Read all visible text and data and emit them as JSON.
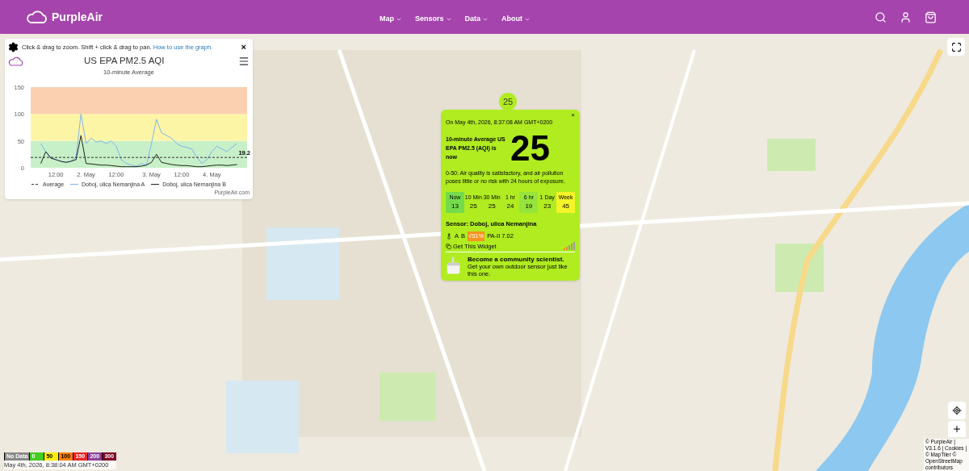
{
  "header": {
    "brand": "PurpleAir",
    "nav": [
      {
        "label": "Map"
      },
      {
        "label": "Sensors"
      },
      {
        "label": "Data"
      },
      {
        "label": "About"
      }
    ]
  },
  "graph_panel": {
    "hint": "Click & drag to zoom. Shift + click & drag to pan. ",
    "hint_link": "How to use the graph.",
    "close": "×",
    "title": "US EPA PM2.5 AQI",
    "subtitle": "10-minute Average",
    "credit": "PurpleAir.com",
    "average_legend": "Average",
    "chart_data": {
      "type": "line",
      "categories": [
        null,
        null,
        null,
        "12:00",
        null,
        null,
        null,
        null,
        null,
        "2. May",
        null,
        null,
        null,
        null,
        null,
        "12:00",
        null,
        null,
        null,
        null,
        null,
        null,
        "3. May",
        null,
        null,
        null,
        null,
        null,
        "12:00",
        null,
        null,
        null,
        null,
        null,
        "4. May",
        null,
        null,
        null,
        null,
        null
      ],
      "ylim": [
        0,
        150
      ],
      "yticks": [
        0,
        50,
        100,
        150
      ],
      "bands": [
        {
          "axis": "y",
          "from": 0,
          "to": 50,
          "color": "#c8f0c8"
        },
        {
          "axis": "y",
          "from": 50,
          "to": 100,
          "color": "#fdf5a6"
        },
        {
          "axis": "y",
          "from": 100,
          "to": 150,
          "color": "#fbd0b0"
        }
      ],
      "ref_lines": [
        {
          "axis": "y",
          "value": 19.2,
          "label": "19.2",
          "color": "#333333"
        }
      ],
      "series": [
        {
          "name": "Doboj, ulica Nemanjina A",
          "color": "#7cb5ec",
          "values": [
            45,
            30,
            20,
            15,
            12,
            10,
            12,
            20,
            100,
            45,
            55,
            48,
            50,
            45,
            50,
            40,
            15,
            8,
            5,
            3,
            8,
            5,
            45,
            90,
            65,
            60,
            55,
            45,
            40,
            38,
            35,
            20,
            8,
            15,
            30,
            40,
            35,
            30,
            38,
            45
          ]
        },
        {
          "name": "Doboj, ulica Nemanjina B",
          "color": "#222222",
          "values": [
            8,
            30,
            18,
            15,
            12,
            10,
            12,
            15,
            60,
            8,
            7,
            6,
            5,
            5,
            4,
            3,
            2,
            2,
            2,
            2,
            3,
            5,
            10,
            25,
            10,
            8,
            6,
            5,
            4,
            4,
            3,
            2,
            2,
            3,
            4,
            5,
            5,
            4,
            5,
            6
          ]
        }
      ]
    }
  },
  "map_marker": {
    "value": "25"
  },
  "popup": {
    "close": "×",
    "timestamp": "On May 4th, 2026, 8:37:08 AM GMT+0200",
    "headline": "10-minute Average US EPA PM2.5 (AQI) is now",
    "value": "25",
    "description": "0-50: Air quality is satisfactory, and air pollution poses little or no risk with 24 hours of exposure.",
    "averages": [
      {
        "label": "Now",
        "value": "13",
        "color": "#74dc4c"
      },
      {
        "label": "10 Min",
        "value": "25",
        "color": "#b0ec20"
      },
      {
        "label": "30 Min",
        "value": "25",
        "color": "#b0ec20"
      },
      {
        "label": "1 hr",
        "value": "24",
        "color": "#b0ec20"
      },
      {
        "label": "6 hr",
        "value": "19",
        "color": "#96e43c"
      },
      {
        "label": "1 Day",
        "value": "23",
        "color": "#b0ec20"
      },
      {
        "label": "Week",
        "value": "45",
        "color": "#f4f428"
      }
    ],
    "sensor": "Sensor: Doboj, ulica Nemanjina",
    "channel_a": "A",
    "channel_b": "B",
    "confidence": "√51%",
    "model": "PA-II 7.02",
    "widget_link": "Get This Widget",
    "promo_title": "Become a community scientist.",
    "promo_text": "Get your own outdoor sensor just like this one."
  },
  "legend": {
    "scale": [
      {
        "label": "No Data",
        "color": "#888888"
      },
      {
        "label": "0",
        "color": "#44cc22"
      },
      {
        "label": "50",
        "color": "#ffee00"
      },
      {
        "label": "100",
        "color": "#ff7e00"
      },
      {
        "label": "150",
        "color": "#ee2222"
      },
      {
        "label": "200",
        "color": "#8f3f97"
      },
      {
        "label": "300",
        "color": "#7e0023"
      }
    ],
    "timestamp": "May 4th, 2026, 8:38:04 AM GMT+0200"
  },
  "attribution": "© PurpleAir | V3.1.6 | Cookies | © MapTiler © OpenStreetMap contributors"
}
